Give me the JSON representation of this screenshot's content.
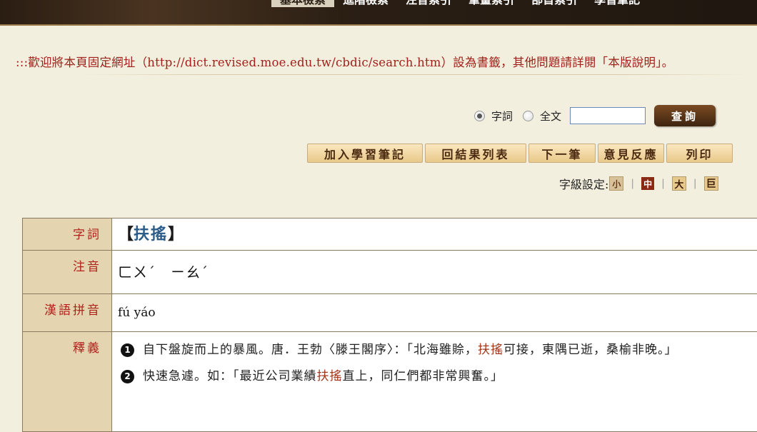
{
  "nav": {
    "items": [
      "基本檢索",
      "進階檢索",
      "注音索引",
      "筆畫索引",
      "部首索引",
      "學習筆記"
    ]
  },
  "notice": ":::歡迎將本頁固定網址（http://dict.revised.moe.edu.tw/cbdic/search.htm）設為書籤，其他問題請詳閱「本版說明」。",
  "search": {
    "option_word": "字詞",
    "option_full": "全文",
    "input_value": "",
    "submit_label": "查詢"
  },
  "actions": {
    "add_note": "加入學習筆記",
    "back_list": "回結果列表",
    "next": "下一筆",
    "feedback": "意見反應",
    "print": "列印"
  },
  "font_size": {
    "label": "字級設定:",
    "small": "小",
    "medium": "中",
    "large": "大",
    "huge": "巨"
  },
  "entry": {
    "label_word": "字詞",
    "label_zhuyin": "注音",
    "label_pinyin": "漢語拼音",
    "label_def": "釋義",
    "bracket_open": "【",
    "word": "扶搖",
    "bracket_close": "】",
    "zhuyin": "ㄈㄨˊ　ㄧㄠˊ",
    "pinyin": "fú yáo",
    "definitions": [
      {
        "num": "1",
        "before": "自下盤旋而上的暴風。唐．王勃〈滕王閣序〉：「北海雖賒，",
        "highlight": "扶搖",
        "after": "可接，東隅已逝，桑榆非晚。」"
      },
      {
        "num": "2",
        "before": "快速急遽。如：「最近公司業績",
        "highlight": "扶搖",
        "after": "直上，同仁們都非常興奮。」"
      }
    ]
  },
  "colors": {
    "accent_red": "#a3201a",
    "label_bg": "#e4d5b0",
    "word_blue": "#2c5c8a"
  }
}
